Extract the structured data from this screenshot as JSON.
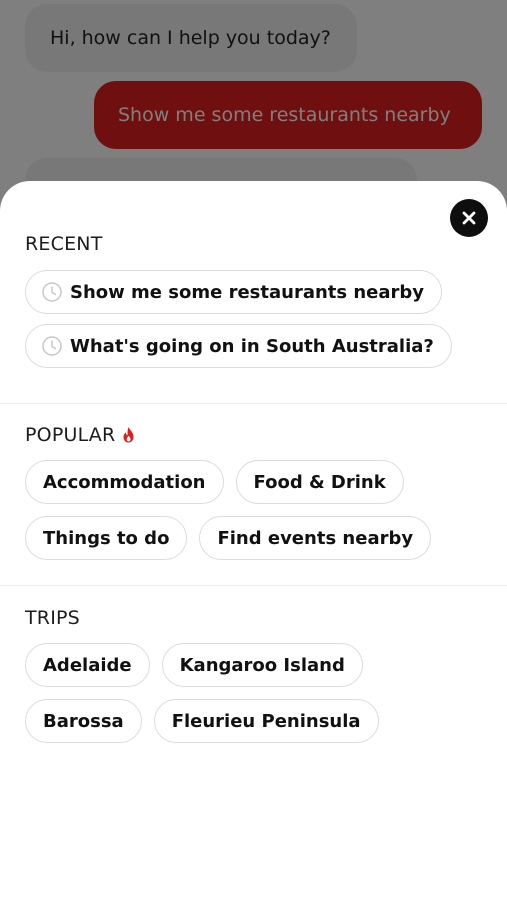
{
  "chat": {
    "bot_message": "Hi, how can I help you today?",
    "user_message": "Show me some restaurants nearby"
  },
  "sheet": {
    "recent": {
      "title": "RECENT",
      "items": [
        "Show me some restaurants nearby",
        "What's going on in South Australia?"
      ]
    },
    "popular": {
      "title": "POPULAR",
      "items": [
        "Accommodation",
        "Food & Drink",
        "Things to do",
        "Find events nearby"
      ]
    },
    "trips": {
      "title": "TRIPS",
      "items": [
        "Adelaide",
        "Kangaroo Island",
        "Barossa",
        "Fleurieu Peninsula"
      ]
    }
  },
  "icons": {
    "close": "close-icon",
    "clock": "clock-icon",
    "flame": "flame-icon"
  },
  "colors": {
    "accent_red": "#e01e1e",
    "bot_bubble": "#f1f1f1",
    "close_button": "#0e0e0e",
    "chip_border": "#dcdcdc"
  }
}
